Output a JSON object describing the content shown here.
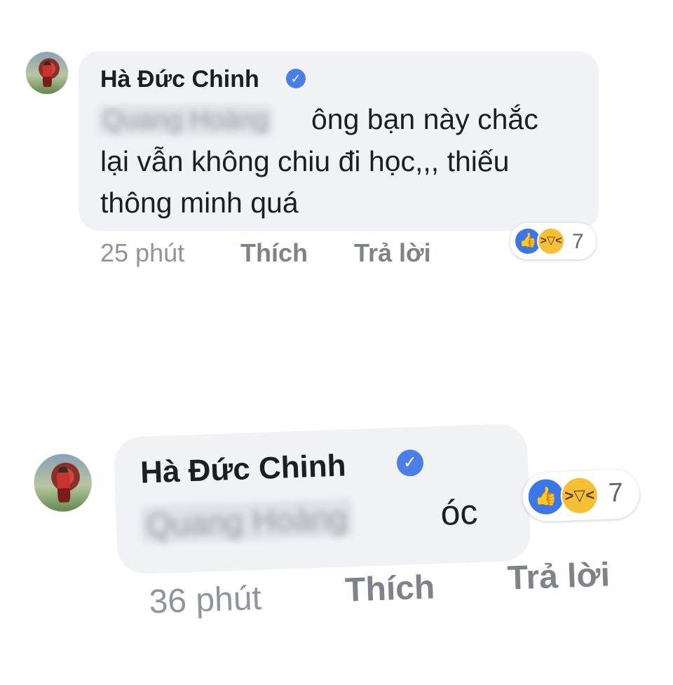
{
  "comments": [
    {
      "author": "Hà Đức Chinh",
      "verified_icon": "verified-check-icon",
      "mention": "Quang Hoàng",
      "text_lines": [
        "ông bạn này chắc",
        "lại vẫn không chiu đi học,,, thiếu",
        "thông minh quá"
      ],
      "time": "25 phút",
      "like_label": "Thích",
      "reply_label": "Trả lời",
      "reactions": {
        "icons": [
          "like-icon",
          "haha-icon"
        ],
        "count": "7"
      }
    },
    {
      "author": "Hà Đức Chinh",
      "verified_icon": "verified-check-icon",
      "mention": "Quang Hoàng",
      "text_lines": [
        "óc"
      ],
      "time": "36 phút",
      "like_label": "Thích",
      "reply_label": "Trả lời",
      "reactions": {
        "icons": [
          "like-icon",
          "haha-icon"
        ],
        "count": "7"
      }
    }
  ],
  "colors": {
    "bubble": "#f1f2f6",
    "verified": "#4a7fe8",
    "like_reaction": "#3b78e7",
    "haha_reaction": "#f7c034",
    "meta_text": "#90949c"
  }
}
